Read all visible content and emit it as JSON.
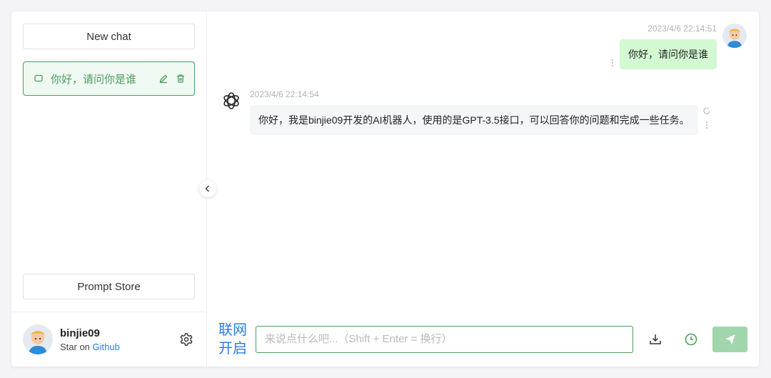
{
  "sidebar": {
    "new_chat_label": "New chat",
    "history": [
      {
        "title": "你好，请问你是谁"
      }
    ],
    "prompt_store_label": "Prompt Store",
    "user": {
      "name": "binjie09",
      "sub_prefix": "Star on",
      "sub_link": "Github"
    }
  },
  "chat": {
    "messages": [
      {
        "role": "user",
        "time": "2023/4/6 22:14:51",
        "text": "你好，请问你是谁"
      },
      {
        "role": "assistant",
        "time": "2023/4/6 22:14:54",
        "text": "你好，我是binjie09开发的AI机器人，使用的是GPT-3.5接口，可以回答你的问题和完成一些任务。"
      }
    ]
  },
  "footer": {
    "net_toggle_line1": "联网",
    "net_toggle_line2": "开启",
    "input_placeholder": "来说点什么吧...（Shift + Enter = 换行）"
  },
  "colors": {
    "accent": "#4b9e5f",
    "link": "#2a7de1",
    "user_bubble": "#d2f9d1",
    "send_button": "#a1d6ad"
  },
  "icons": {
    "history_item": "chat-bubble-icon",
    "edit": "pencil-icon",
    "delete": "trash-icon",
    "settings": "gear-icon",
    "collapse": "chevron-left-icon",
    "assistant": "openai-logo-icon",
    "export": "download-icon",
    "history": "clock-icon",
    "send": "send-icon"
  }
}
